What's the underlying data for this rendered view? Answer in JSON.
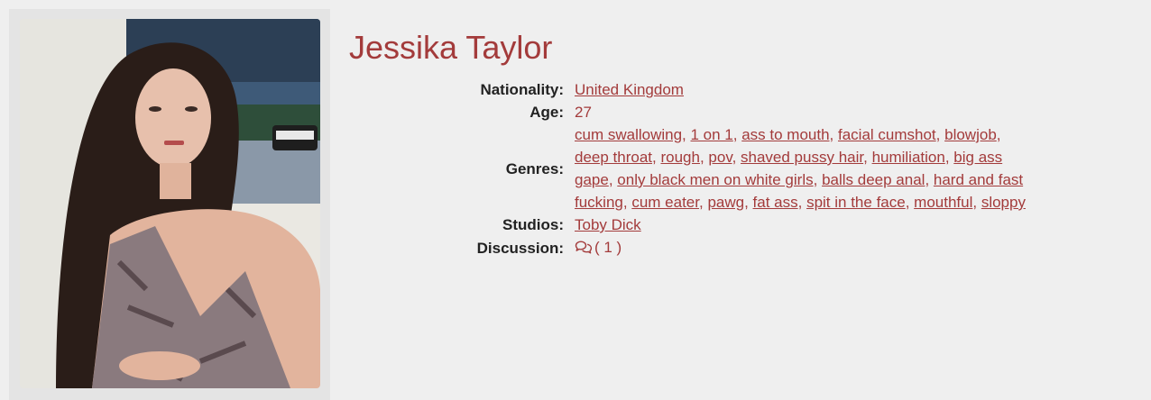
{
  "performer": {
    "name": "Jessika Taylor"
  },
  "details": {
    "nationality_label": "Nationality:",
    "nationality": "United Kingdom",
    "age_label": "Age:",
    "age": "27",
    "genres_label": "Genres:",
    "genres": [
      "cum swallowing",
      "1 on 1",
      "ass to mouth",
      "facial cumshot",
      "blowjob",
      "deep throat",
      "rough",
      "pov",
      "shaved pussy hair",
      "humiliation",
      "big ass gape",
      "only black men on white girls",
      "balls deep anal",
      "hard and fast fucking",
      "cum eater",
      "pawg",
      "fat ass",
      "spit in the face",
      "mouthful",
      "sloppy"
    ],
    "studios_label": "Studios:",
    "studio": "Toby Dick",
    "discussion_label": "Discussion:",
    "discussion_count": "( 1 )"
  },
  "colors": {
    "accent": "#a33b3b",
    "label": "#222222",
    "background": "#efefef"
  },
  "icons": {
    "discussion": "comments-icon"
  }
}
